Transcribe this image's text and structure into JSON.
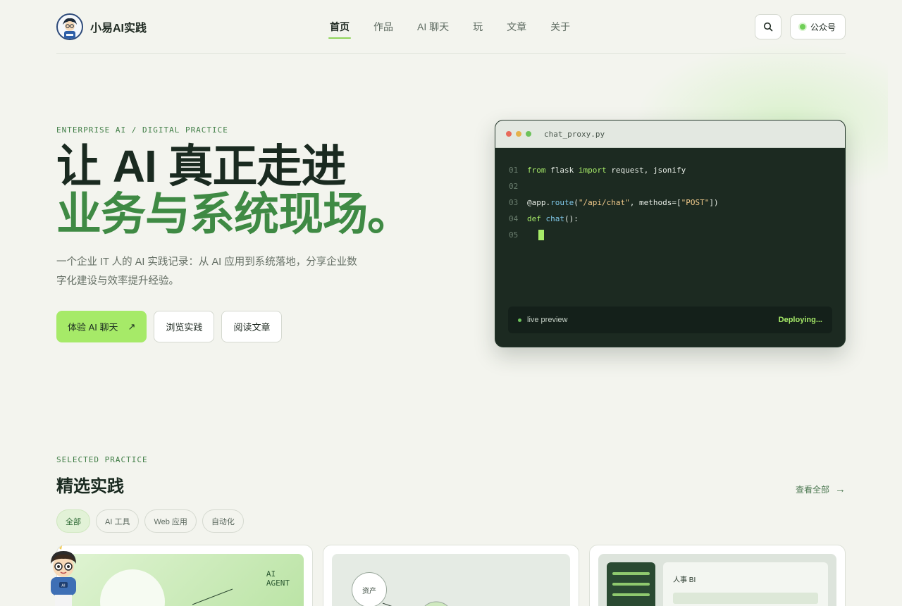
{
  "brand": {
    "name": "小易AI实践"
  },
  "nav": [
    {
      "label": "首页",
      "active": true
    },
    {
      "label": "作品",
      "active": false
    },
    {
      "label": "AI 聊天",
      "active": false
    },
    {
      "label": "玩",
      "active": false
    },
    {
      "label": "文章",
      "active": false
    },
    {
      "label": "关于",
      "active": false
    }
  ],
  "header": {
    "wechat_label": "公众号",
    "search_icon": "search-icon"
  },
  "hero": {
    "eyebrow": "ENTERPRISE AI / DIGITAL PRACTICE",
    "line1": "让 AI 真正走进",
    "line2": "业务与系统现场。",
    "desc": "一个企业 IT 人的 AI 实践记录：从 AI 应用到系统落地，分享企业数字化建设与效率提升经验。",
    "cta_primary": "体验 AI 聊天",
    "cta_primary_arrow": "↗",
    "cta_secondary": "浏览实践",
    "cta_tertiary": "阅读文章"
  },
  "code": {
    "file_name": "chat_proxy.py",
    "lines": [
      {
        "no": "01",
        "tokens": [
          [
            "kw",
            "from"
          ],
          [
            "tx",
            " flask "
          ],
          [
            "kw",
            "import"
          ],
          [
            "tx",
            " request, jsonify"
          ]
        ]
      },
      {
        "no": "02",
        "tokens": []
      },
      {
        "no": "03",
        "tokens": [
          [
            "tx",
            "@app."
          ],
          [
            "fn",
            "route"
          ],
          [
            "tx",
            "("
          ],
          [
            "st",
            "\"/api/chat\""
          ],
          [
            "tx",
            ", methods=["
          ],
          [
            "st",
            "\"POST\""
          ],
          [
            "tx",
            "])"
          ]
        ]
      },
      {
        "no": "04",
        "tokens": [
          [
            "kw",
            "def"
          ],
          [
            "tx",
            " "
          ],
          [
            "fn",
            "chat"
          ],
          [
            "tx",
            "():"
          ]
        ]
      },
      {
        "no": "05",
        "tokens": [],
        "cursor": true
      }
    ],
    "status_left": "live preview",
    "status_right": "Deploying..."
  },
  "practice": {
    "eyebrow": "SELECTED PRACTICE",
    "title": "精选实践",
    "view_all": "查看全部",
    "view_all_arrow": "→",
    "filters": [
      {
        "label": "全部",
        "active": true
      },
      {
        "label": "AI 工具",
        "active": false
      },
      {
        "label": "Web 应用",
        "active": false
      },
      {
        "label": "自动化",
        "active": false
      }
    ],
    "cards": [
      {
        "tag_line1": "AI",
        "tag_line2": "AGENT"
      },
      {
        "node_label": "资产"
      },
      {
        "panel_title": "人事 BI"
      }
    ]
  },
  "colors": {
    "accent": "#a6ea68",
    "brand_green": "#3f8a44",
    "code_bg": "#1c2a21"
  }
}
